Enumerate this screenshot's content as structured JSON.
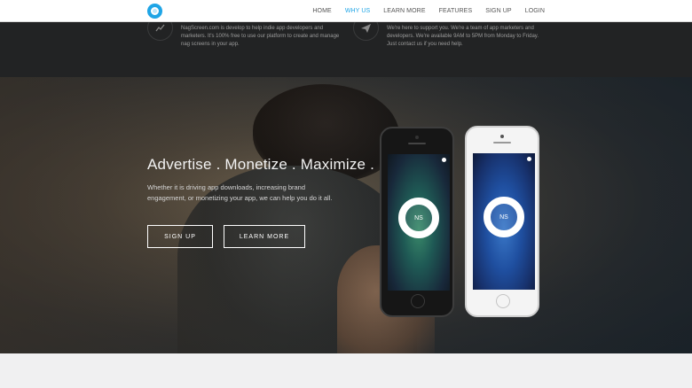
{
  "nav": {
    "items": [
      {
        "label": "HOME"
      },
      {
        "label": "WHY US"
      },
      {
        "label": "LEARN MORE"
      },
      {
        "label": "FEATURES"
      },
      {
        "label": "SIGN UP"
      },
      {
        "label": "LOGIN"
      }
    ],
    "active_index": 1
  },
  "features": {
    "left": {
      "icon": "chart-icon",
      "text": "NagScreen.com is develop to help indie app developers and marketers. It's 100% free to use our platform to create and manage nag screens in your app."
    },
    "right": {
      "icon": "paper-plane-icon",
      "text": "We're here to support you. We're a team of app marketers and developers. We're available 9AM to 5PM from Monday to Friday. Just contact us if you need help."
    }
  },
  "hero": {
    "title": "Advertise . Monetize . Maximize .",
    "subtitle": "Whether it is driving app downloads, increasing brand engagement, or monetizing your app, we can help you do it all.",
    "signup_label": "SIGN UP",
    "learn_label": "LEARN MORE",
    "phone_badge": "NS"
  },
  "colors": {
    "accent": "#1fa5e6",
    "dark_strip": "#222324"
  }
}
